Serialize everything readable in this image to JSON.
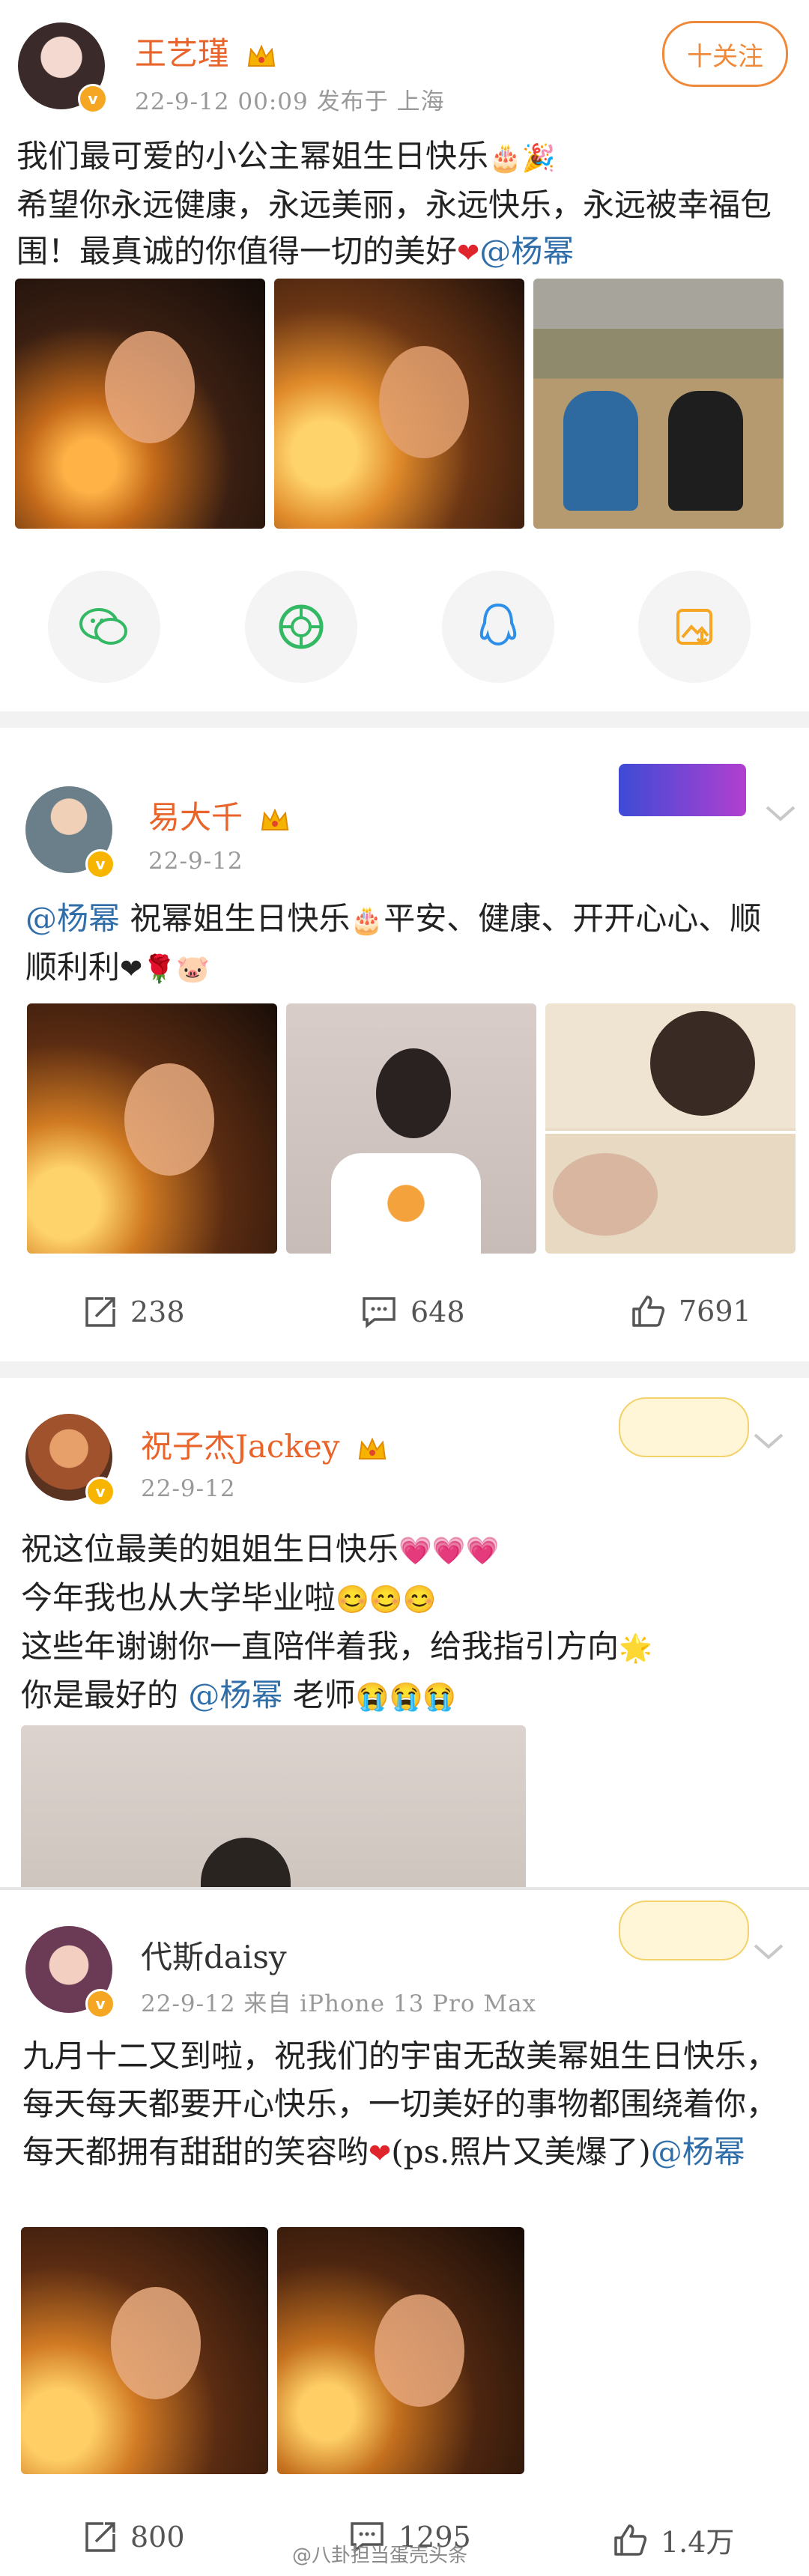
{
  "posts": [
    {
      "username": "王艺瑾",
      "meta": "22-9-12 00:09  发布于 上海",
      "follow_label": "十关注",
      "text_prefix": "我们最可爱的小公主幂姐生日快乐",
      "text_line2": "希望你永远健康，永远美丽，永远快乐，永远被幸福包围！最真诚的你值得一切的美好",
      "mention": "@杨幂"
    },
    {
      "username": "易大千",
      "meta": "22-9-12",
      "mention": "@杨幂",
      "text": " 祝幂姐生日快乐",
      "text2": "平安、健康、开开心心、顺顺利利",
      "actions": {
        "reposts": "238",
        "comments": "648",
        "likes": "7691"
      }
    },
    {
      "username": "祝子杰Jackey",
      "meta": "22-9-12",
      "line1": "祝这位最美的姐姐生日快乐",
      "line2": "今年我也从大学毕业啦",
      "line3": "这些年谢谢你一直陪伴着我，给我指引方向",
      "line4_prefix": "你是最好的 ",
      "mention": "@杨幂",
      "line4_suffix": " 老师"
    },
    {
      "username": "代斯daisy",
      "meta": "22-9-12  来自 iPhone 13 Pro Max",
      "text": "九月十二又到啦，祝我们的宇宙无敌美幂姐生日快乐，每天每天都要开心快乐，一切美好的事物都围绕着你，每天都拥有甜甜的笑容哟",
      "text_tail": "(ps.照片又美爆了)",
      "mention": "@杨幂",
      "actions": {
        "reposts": "800",
        "comments": "1295",
        "likes": "1.4万"
      }
    }
  ],
  "watermark": "@八卦担当蛋壳头条",
  "colors": {
    "username": "#e8642b",
    "mention": "#2f6ea9",
    "meta": "#999999"
  },
  "share_icons": [
    "wechat-icon",
    "moments-icon",
    "qq-icon",
    "save-image-icon"
  ]
}
